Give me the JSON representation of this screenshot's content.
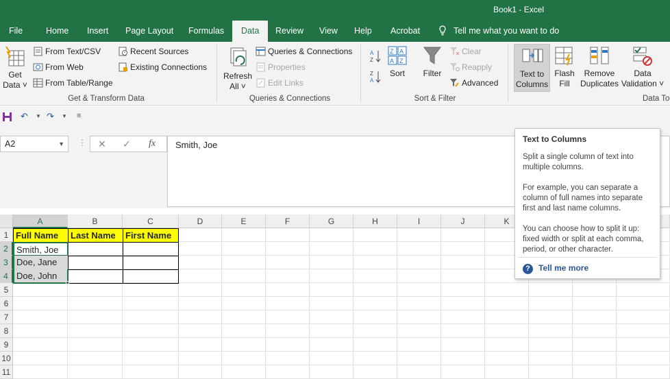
{
  "window": {
    "title": "Book1  -  Excel"
  },
  "tabs": [
    "File",
    "Home",
    "Insert",
    "Page Layout",
    "Formulas",
    "Data",
    "Review",
    "View",
    "Help",
    "Acrobat"
  ],
  "tell_me": "Tell me what you want to do",
  "ribbon": {
    "get_transform": {
      "get_data_line1": "Get",
      "get_data_line2": "Data ˅",
      "from_text_csv": "From Text/CSV",
      "from_web": "From Web",
      "from_table_range": "From Table/Range",
      "recent_sources": "Recent Sources",
      "existing_connections": "Existing Connections",
      "label": "Get & Transform Data"
    },
    "queries": {
      "refresh_line1": "Refresh",
      "refresh_line2": "All ˅",
      "queries_connections": "Queries & Connections",
      "properties": "Properties",
      "edit_links": "Edit Links",
      "label": "Queries & Connections"
    },
    "sort_filter": {
      "sort": "Sort",
      "filter": "Filter",
      "clear": "Clear",
      "reapply": "Reapply",
      "advanced": "Advanced",
      "label": "Sort & Filter"
    },
    "data_tools": {
      "text_to_columns_line1": "Text to",
      "text_to_columns_line2": "Columns",
      "flash_fill_line1": "Flash",
      "flash_fill_line2": "Fill",
      "remove_duplicates_line1": "Remove",
      "remove_duplicates_line2": "Duplicates",
      "data_validation_line1": "Data",
      "data_validation_line2": "Validation ˅",
      "label": "Data To"
    }
  },
  "formula_bar": {
    "name_box": "A2",
    "value": "Smith, Joe"
  },
  "grid": {
    "columns": [
      "A",
      "B",
      "C",
      "D",
      "E",
      "F",
      "G",
      "H",
      "I",
      "J",
      "K"
    ],
    "rows": [
      "1",
      "2",
      "3",
      "4",
      "5",
      "6",
      "7",
      "8",
      "9",
      "10",
      "11"
    ],
    "headers": [
      "Full Name",
      "Last Name",
      "First Name"
    ],
    "names": [
      "Smith, Joe",
      "Doe, Jane",
      "Doe, John"
    ]
  },
  "tooltip": {
    "title": "Text to Columns",
    "p1": "Split a single column of text into multiple columns.",
    "p2": "For example, you can separate a column of full names into separate first and last name columns.",
    "p3": "You can choose how to split it up: fixed width or split at each comma, period, or other character.",
    "link": "Tell me more"
  },
  "colors": {
    "accent": "#217346",
    "header_fill": "#ffff00",
    "link": "#2b579a"
  }
}
